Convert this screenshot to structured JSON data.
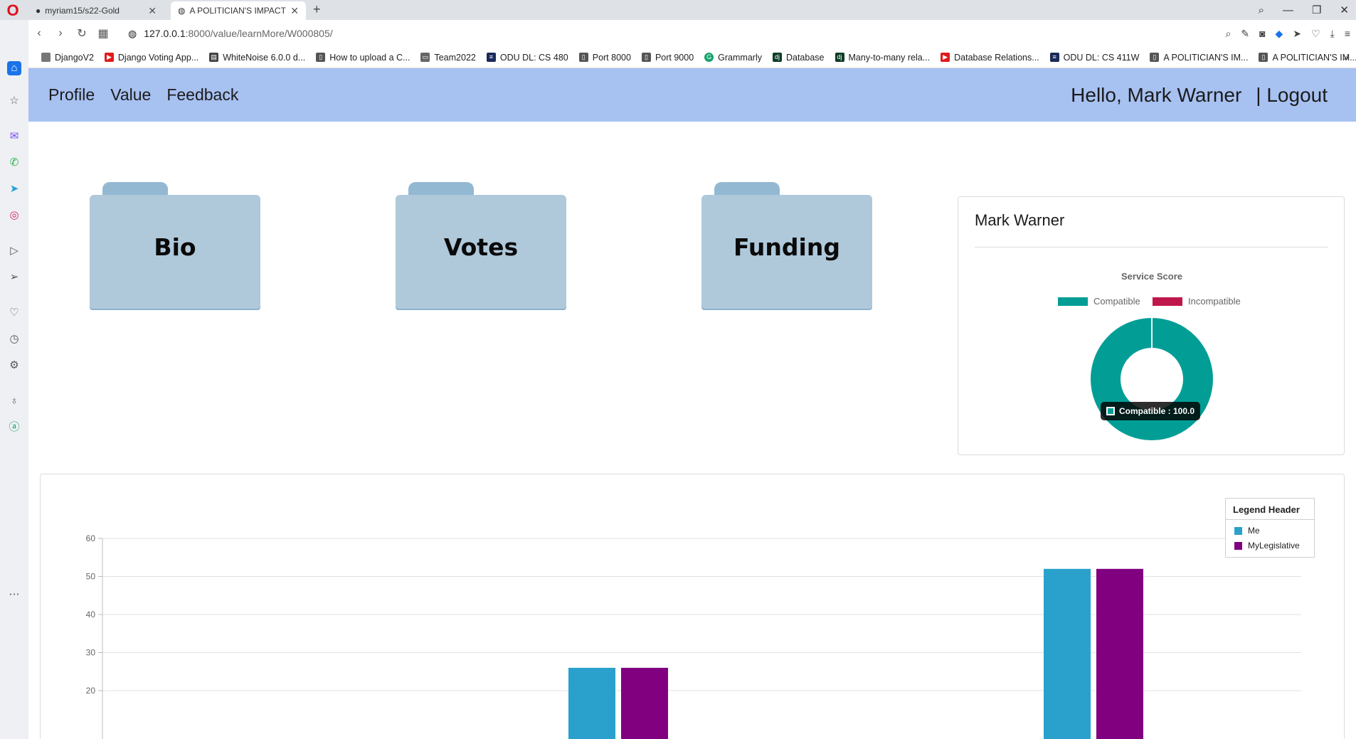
{
  "browser": {
    "tabs": [
      {
        "title": "myriam15/s22-Gold",
        "active": false
      },
      {
        "title": "A POLITICIAN'S IMPACT",
        "active": true
      }
    ],
    "url_host": "127.0.0.1",
    "url_path": ":8000/value/learnMore/W000805/",
    "bookmarks": [
      {
        "label": "DjangoV2",
        "icon": "blank-page-icon",
        "color": "#666666"
      },
      {
        "label": "Django Voting App...",
        "icon": "youtube-icon",
        "color": "#e01b1b"
      },
      {
        "label": "WhiteNoise 6.0.0 d...",
        "icon": "doc-icon",
        "color": "#444444"
      },
      {
        "label": "How to upload a C...",
        "icon": "page-icon",
        "color": "#555555"
      },
      {
        "label": "Team2022",
        "icon": "folder-icon",
        "color": "#555555"
      },
      {
        "label": "ODU DL: CS 480",
        "icon": "odu-icon",
        "color": "#1b2a5a"
      },
      {
        "label": "Port 8000",
        "icon": "page-icon",
        "color": "#555555"
      },
      {
        "label": "Port 9000",
        "icon": "page-icon",
        "color": "#555555"
      },
      {
        "label": "Grammarly",
        "icon": "grammarly-icon",
        "color": "#15a36b"
      },
      {
        "label": "Database",
        "icon": "django-icon",
        "color": "#0c3c26"
      },
      {
        "label": "Many-to-many rela...",
        "icon": "django-icon",
        "color": "#0c3c26"
      },
      {
        "label": "Database Relations...",
        "icon": "youtube-icon",
        "color": "#e01b1b"
      },
      {
        "label": "ODU DL: CS 411W",
        "icon": "odu-icon",
        "color": "#1b2a5a"
      },
      {
        "label": "A POLITICIAN'S IM...",
        "icon": "page-icon",
        "color": "#555555"
      },
      {
        "label": "A POLITICIAN'S IM...",
        "icon": "page-icon",
        "color": "#555555"
      }
    ]
  },
  "nav": {
    "links": [
      "Profile",
      "Value",
      "Feedback"
    ],
    "greeting": "Hello, Mark Warner",
    "logout": "| Logout",
    "bg_color": "#a7c1f1"
  },
  "folders": [
    {
      "label": "Bio"
    },
    {
      "label": "Votes"
    },
    {
      "label": "Funding"
    }
  ],
  "score_card": {
    "name": "Mark Warner",
    "chart_title": "Service Score",
    "legend": [
      {
        "label": "Compatible",
        "color": "#029e96"
      },
      {
        "label": "Incompatible",
        "color": "#c0174a"
      }
    ],
    "tooltip": "Compatible : 100.0"
  },
  "bar_legend": {
    "header": "Legend Header",
    "items": [
      {
        "label": "Me",
        "color": "#2aa1cc"
      },
      {
        "label": "MyLegislative",
        "color": "#800080"
      }
    ]
  },
  "chart_data": [
    {
      "type": "pie",
      "title": "Service Score",
      "categories": [
        "Compatible",
        "Incompatible"
      ],
      "values": [
        100.0,
        0.0
      ],
      "donut": true,
      "legend": "top"
    },
    {
      "type": "bar",
      "title": "",
      "y_ticks": [
        20,
        30,
        40,
        50,
        60
      ],
      "ylim": [
        20,
        60
      ],
      "grid": true,
      "legend": "top-right",
      "series": [
        {
          "name": "Me",
          "color": "#2aa1cc",
          "values": [
            26,
            52
          ]
        },
        {
          "name": "MyLegislative",
          "color": "#800080",
          "values": [
            26,
            52
          ]
        }
      ]
    }
  ]
}
